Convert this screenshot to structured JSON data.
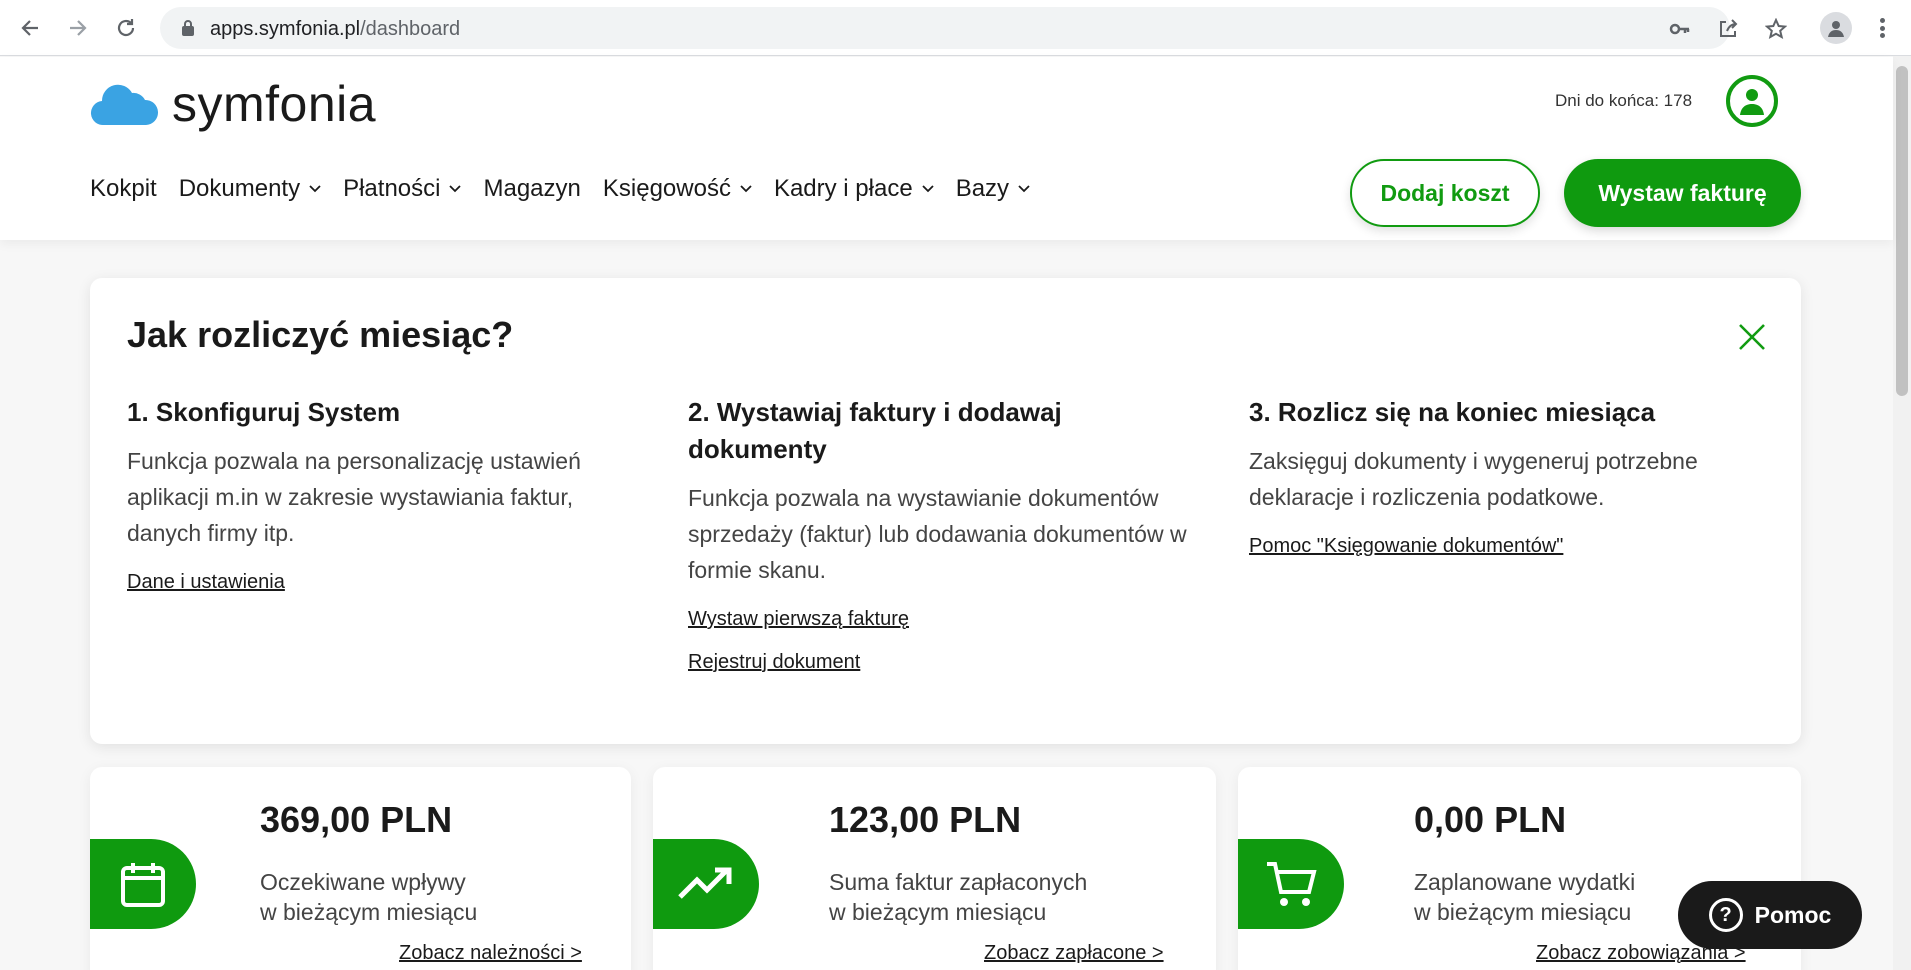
{
  "browser": {
    "url_host": "apps.symfonia.pl",
    "url_path": "/dashboard"
  },
  "header": {
    "logo_text": "symfonia",
    "days_left": "Dni do końca: 178",
    "menu": [
      {
        "label": "Kokpit"
      },
      {
        "label": "Dokumenty"
      },
      {
        "label": "Płatności"
      },
      {
        "label": "Magazyn"
      },
      {
        "label": "Księgowość"
      },
      {
        "label": "Kadry i płace"
      },
      {
        "label": "Bazy"
      }
    ],
    "add_cost": "Dodaj koszt",
    "issue_invoice": "Wystaw fakturę"
  },
  "guide": {
    "title": "Jak rozliczyć miesiąc?",
    "steps": [
      {
        "title": "1. Skonfiguruj System",
        "text": "Funkcja pozwala na personalizację ustawień aplikacji m.in w zakresie wystawiania faktur, danych firmy itp.",
        "links": [
          "Dane i ustawienia"
        ]
      },
      {
        "title": "2. Wystawiaj faktury i dodawaj dokumenty",
        "text": "Funkcja pozwala na wystawianie dokumentów sprzedaży (faktur) lub dodawania dokumentów w formie skanu.",
        "links": [
          "Wystaw pierwszą fakturę",
          "Rejestruj dokument"
        ]
      },
      {
        "title": "3. Rozlicz się na koniec miesiąca",
        "text": "Zaksięguj dokumenty i wygeneruj potrzebne deklaracje i rozliczenia podatkowe.",
        "links": [
          "Pomoc \"Księgowanie dokumentów\""
        ]
      }
    ]
  },
  "stats": [
    {
      "amount": "369,00 PLN",
      "line1": "Oczekiwane wpływy",
      "line2": "w bieżącym miesiącu",
      "link": "Zobacz należności >",
      "icon": "calendar-icon"
    },
    {
      "amount": "123,00 PLN",
      "line1": "Suma faktur zapłaconych",
      "line2": "w bieżącym miesiącu",
      "link": "Zobacz zapłacone >",
      "icon": "trend-up-icon"
    },
    {
      "amount": "0,00 PLN",
      "line1": "Zaplanowane wydatki",
      "line2": "w bieżącym miesiącu",
      "link": "Zobacz zobowiązania >",
      "icon": "cart-icon"
    }
  ],
  "help": {
    "label": "Pomoc"
  },
  "colors": {
    "accent": "#0f9a0f",
    "logo_cloud": "#3aa3e3"
  }
}
